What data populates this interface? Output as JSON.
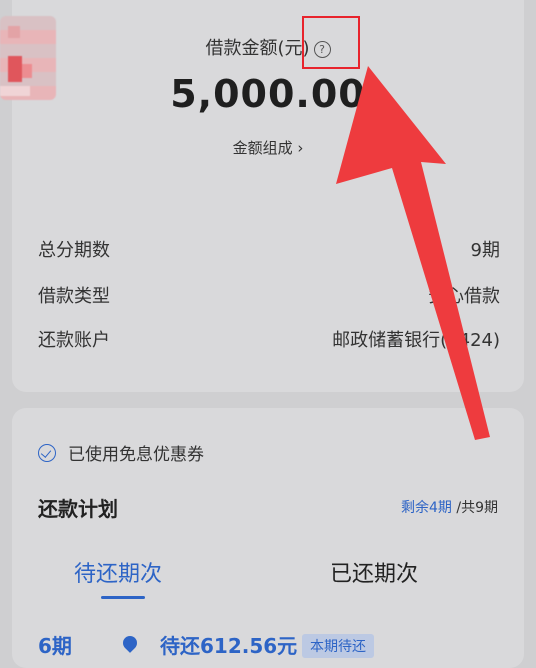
{
  "header": {
    "amount_title": "借款金额(元)",
    "help_icon": "question-circle-icon",
    "amount_value": "5,000.00",
    "composition_label": "金额组成 ›"
  },
  "details": [
    {
      "label": "总分期数",
      "value": "9期"
    },
    {
      "label": "借款类型",
      "value": "安心借款"
    },
    {
      "label": "还款账户",
      "value": "邮政储蓄银行(2424)"
    }
  ],
  "coupon": {
    "text": "已使用免息优惠券",
    "icon": "check-circle-icon"
  },
  "plan": {
    "title": "还款计划",
    "remaining": "剩余4期",
    "total": "/共9期"
  },
  "tabs": [
    {
      "label": "待还期次",
      "active": true
    },
    {
      "label": "已还期次",
      "active": false
    }
  ],
  "schedule_row": {
    "period": "6期",
    "amount": "待还612.56元",
    "badge": "本期待还"
  },
  "colors": {
    "accent": "#2d64c6",
    "annotation_red": "#e8232c"
  }
}
